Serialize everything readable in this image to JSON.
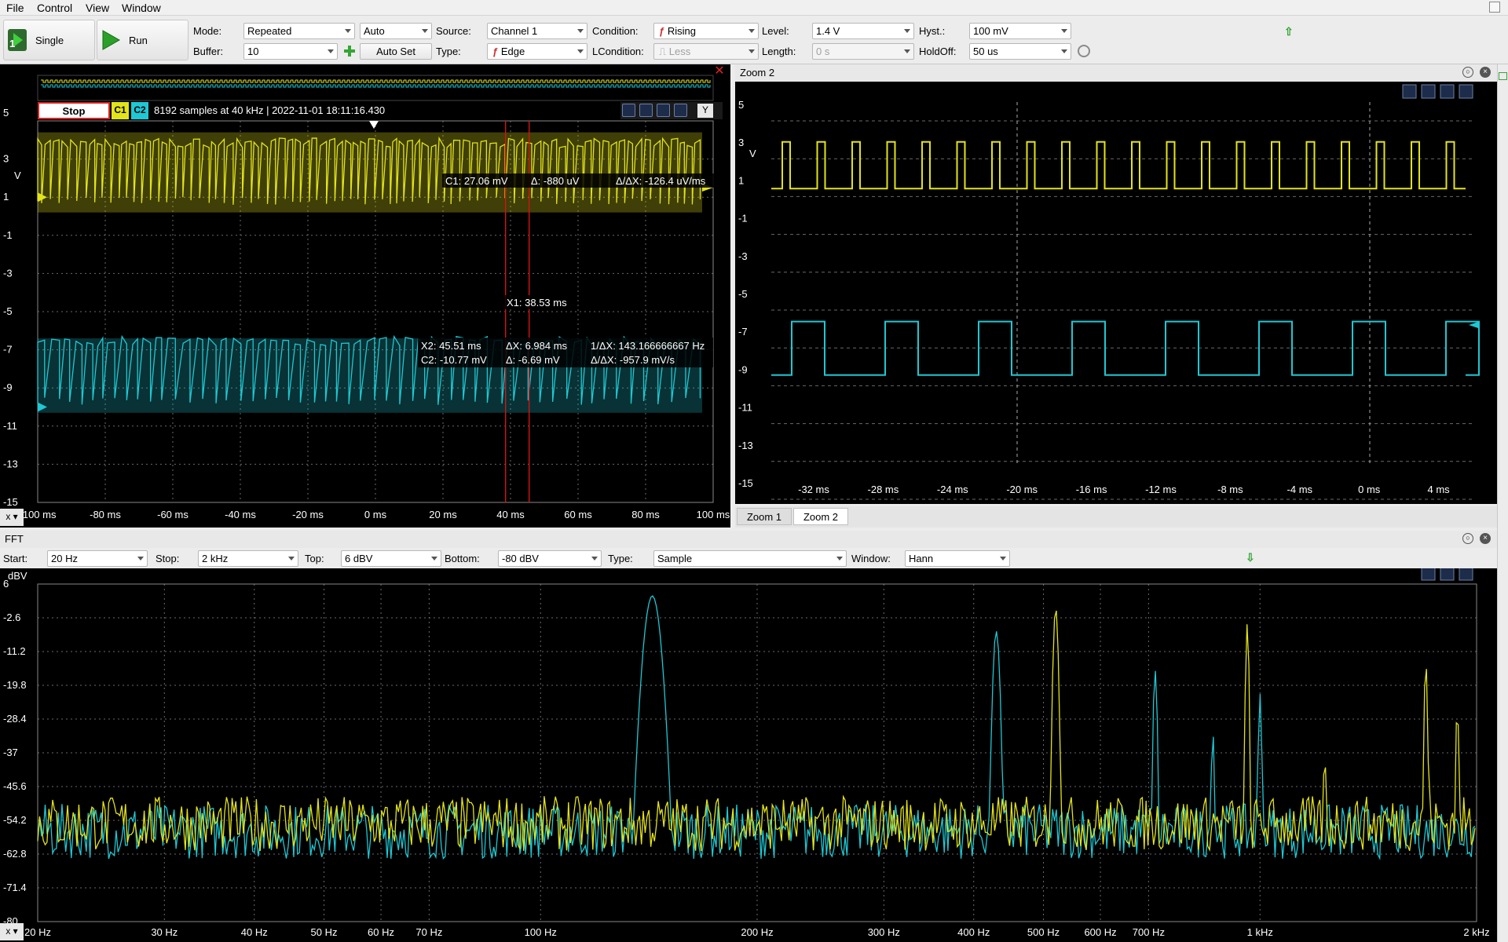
{
  "menu": [
    "File",
    "Control",
    "View",
    "Window"
  ],
  "toolbar": {
    "single_label": "Single",
    "run_label": "Run",
    "mode_label": "Mode:",
    "mode_value": "Repeated",
    "auto_value": "Auto",
    "buffer_label": "Buffer:",
    "buffer_value": "10",
    "autoset_label": "Auto Set",
    "source_label": "Source:",
    "source_value": "Channel 1",
    "type_label": "Type:",
    "type_value": "Edge",
    "condition_label": "Condition:",
    "condition_value": "Rising",
    "lcondition_label": "LCondition:",
    "lcondition_value": "Less",
    "level_label": "Level:",
    "level_value": "1.4 V",
    "length_label": "Length:",
    "length_value": "0 s",
    "hyst_label": "Hyst.:",
    "hyst_value": "100 mV",
    "holdoff_label": "HoldOff:",
    "holdoff_value": "50 us"
  },
  "scope": {
    "stop_label": "Stop",
    "c1_label": "C1",
    "c2_label": "C2",
    "status": "8192 samples at 40 kHz | 2022-11-01 18:11:16.430",
    "y_unit": "V",
    "y_button": "Y",
    "x_button": "x",
    "yticks": [
      "5",
      "3",
      "1",
      "-1",
      "-3",
      "-5",
      "-7",
      "-9",
      "-11",
      "-13",
      "-15"
    ],
    "xticks": [
      "-100 ms",
      "-80 ms",
      "-60 ms",
      "-40 ms",
      "-20 ms",
      "0 ms",
      "20 ms",
      "40 ms",
      "60 ms",
      "80 ms",
      "100 ms"
    ],
    "cursor_c1": "C1: 27.06 mV",
    "cursor_delta1": "Δ: -880 uV",
    "cursor_slope1": "Δ/ΔX: -126.4 uV/ms",
    "cursor_x1": "X1: 38.53 ms",
    "cursor_x2": "X2: 45.51 ms",
    "cursor_dx": "ΔX: 6.984 ms",
    "cursor_inv": "1/ΔX: 143.166666667 Hz",
    "cursor_c2": "C2: -10.77 mV",
    "cursor_delta2": "Δ: -6.69 mV",
    "cursor_slope2": "Δ/ΔX: -957.9 mV/s"
  },
  "zoom": {
    "title": "Zoom 2",
    "y_unit": "V",
    "yticks": [
      "5",
      "3",
      "1",
      "-1",
      "-3",
      "-5",
      "-7",
      "-9",
      "-11",
      "-13",
      "-15"
    ],
    "xticks": [
      "-32 ms",
      "-28 ms",
      "-24 ms",
      "-20 ms",
      "-16 ms",
      "-12 ms",
      "-8 ms",
      "-4 ms",
      "0 ms",
      "4 ms"
    ],
    "tabs": [
      "Zoom 1",
      "Zoom 2"
    ]
  },
  "fft": {
    "title": "FFT",
    "start_label": "Start:",
    "start_value": "20 Hz",
    "stop_label": "Stop:",
    "stop_value": "2 kHz",
    "top_label": "Top:",
    "top_value": "6 dBV",
    "bottom_label": "Bottom:",
    "bottom_value": "-80 dBV",
    "type_label": "Type:",
    "type_value": "Sample",
    "window_label": "Window:",
    "window_value": "Hann",
    "y_unit": "dBV",
    "yticks": [
      "6",
      "-2.6",
      "-11.2",
      "-19.8",
      "-28.4",
      "-37",
      "-45.6",
      "-54.2",
      "-62.8",
      "-71.4",
      "-80"
    ],
    "xticks": [
      "20 Hz",
      "30 Hz",
      "40 Hz",
      "50 Hz",
      "60 Hz",
      "70 Hz",
      "100 Hz",
      "200 Hz",
      "300 Hz",
      "400 Hz",
      "500 Hz",
      "600 Hz",
      "700 Hz",
      "1 kHz",
      "2 kHz"
    ]
  },
  "colors": {
    "c1": "#e3e31a",
    "c2": "#1ec8d4",
    "cursor": "#d21414",
    "grid": "#6a6a6a"
  }
}
